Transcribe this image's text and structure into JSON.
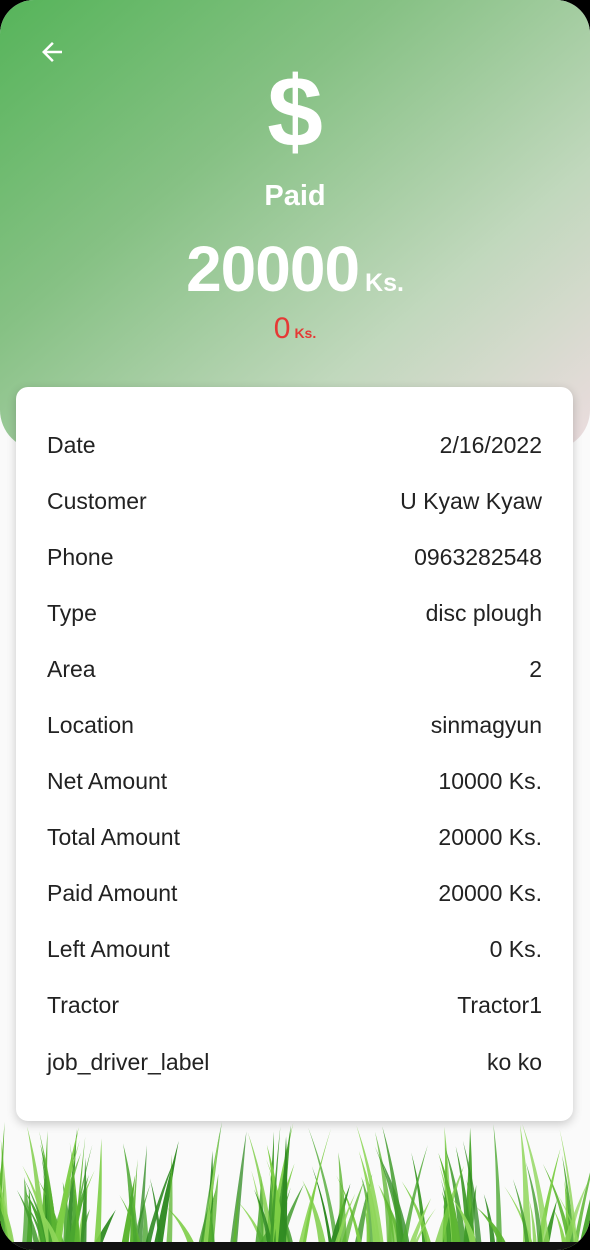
{
  "header": {
    "back_icon": "arrow-left-icon",
    "currency_icon": "dollar-icon",
    "currency_symbol": "$",
    "status": "Paid",
    "amount": "20000",
    "amount_unit": "Ks.",
    "left_amount": "0",
    "left_unit": "Ks.",
    "colors": {
      "gradient_start": "#56b45a",
      "gradient_end": "#ecdcdf",
      "left_amount": "#e53935"
    }
  },
  "details": [
    {
      "label": "Date",
      "value": "2/16/2022"
    },
    {
      "label": "Customer",
      "value": "U Kyaw Kyaw"
    },
    {
      "label": "Phone",
      "value": "0963282548"
    },
    {
      "label": "Type",
      "value": "disc plough"
    },
    {
      "label": "Area",
      "value": "2"
    },
    {
      "label": "Location",
      "value": "sinmagyun"
    },
    {
      "label": "Net Amount",
      "value": "10000 Ks."
    },
    {
      "label": "Total Amount",
      "value": "20000 Ks."
    },
    {
      "label": "Paid Amount",
      "value": "20000 Ks."
    },
    {
      "label": "Left Amount",
      "value": "0 Ks."
    },
    {
      "label": "Tractor",
      "value": "Tractor1"
    },
    {
      "label": "job_driver_label",
      "value": "ko ko"
    }
  ],
  "footer": {
    "decoration": "grass-illustration"
  }
}
